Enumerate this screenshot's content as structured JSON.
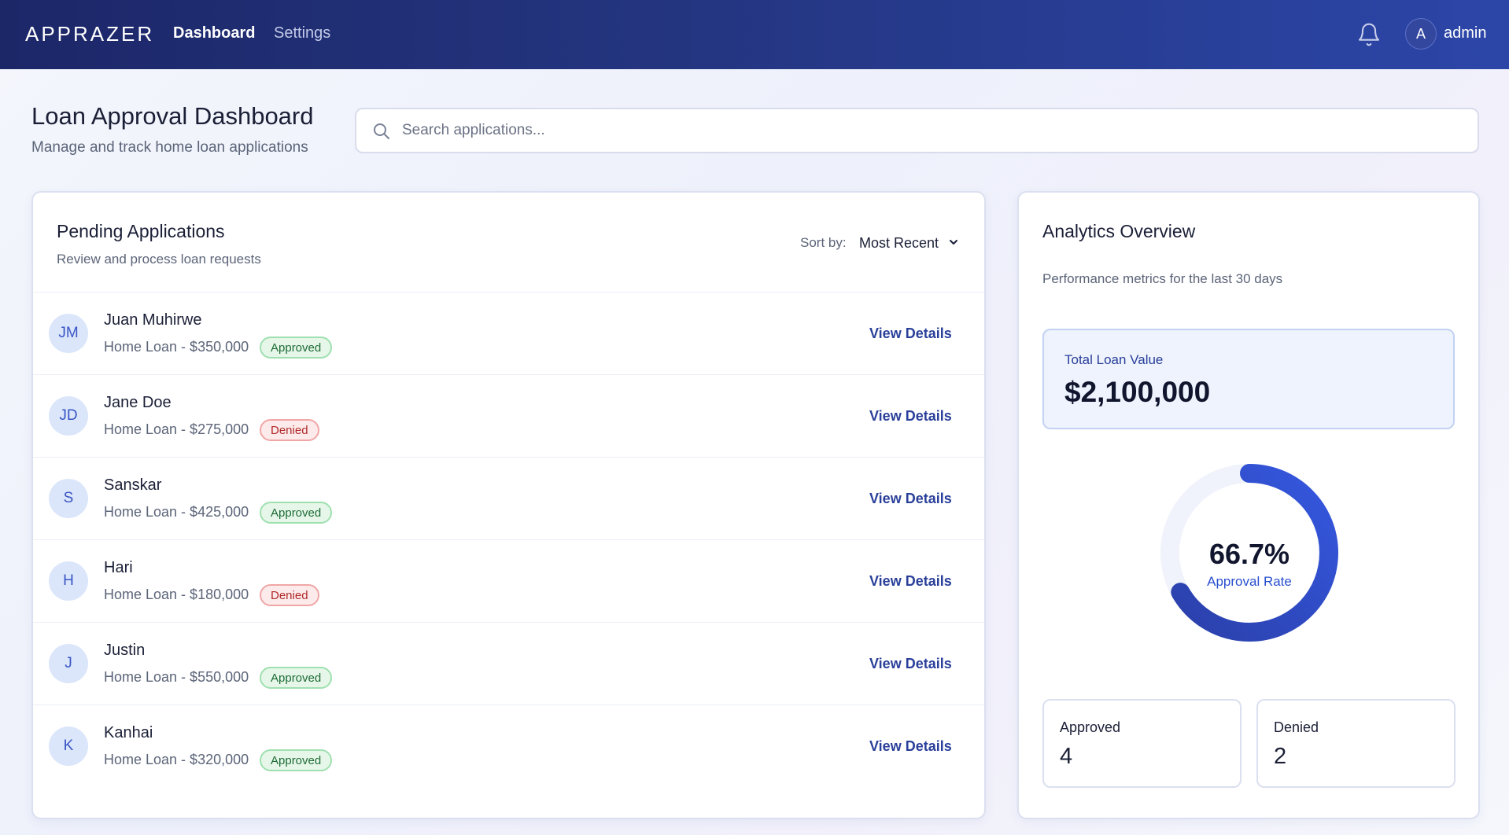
{
  "nav": {
    "logo": "APPRAZER",
    "links": [
      "Dashboard",
      "Settings"
    ],
    "active": "Dashboard",
    "user_initial": "A",
    "user_name": "admin"
  },
  "header": {
    "title": "Loan Approval Dashboard",
    "subtitle": "Manage and track home loan applications"
  },
  "search": {
    "placeholder": "Search applications...",
    "value": ""
  },
  "pending": {
    "title": "Pending Applications",
    "subtitle": "Review and process loan requests",
    "sort_label": "Sort by:",
    "sort_value": "Most Recent",
    "action_label": "View Details",
    "applications": [
      {
        "initials": "JM",
        "name": "Juan Muhirwe",
        "amount": "Home Loan - $350,000",
        "status": "Approved"
      },
      {
        "initials": "JD",
        "name": "Jane Doe",
        "amount": "Home Loan - $275,000",
        "status": "Denied"
      },
      {
        "initials": "S",
        "name": "Sanskar",
        "amount": "Home Loan - $425,000",
        "status": "Approved"
      },
      {
        "initials": "H",
        "name": "Hari",
        "amount": "Home Loan - $180,000",
        "status": "Denied"
      },
      {
        "initials": "J",
        "name": "Justin",
        "amount": "Home Loan - $550,000",
        "status": "Approved"
      },
      {
        "initials": "K",
        "name": "Kanhai",
        "amount": "Home Loan - $320,000",
        "status": "Approved"
      }
    ]
  },
  "analytics": {
    "title": "Analytics Overview",
    "subtitle": "Performance metrics for the last 30 days",
    "total_label": "Total Loan Value",
    "total_value": "$2,100,000",
    "approval_rate_text": "66.7%",
    "approval_rate": 0.667,
    "approval_rate_label": "Approval Rate",
    "approved_label": "Approved",
    "approved_count": "4",
    "denied_label": "Denied",
    "denied_count": "2"
  },
  "colors": {
    "nav_start": "#1c2768",
    "nav_end": "#2c46a8",
    "accent": "#2a3f9a",
    "donut": "#2f4fd6",
    "approved_bg": "#e6f7ea",
    "denied_bg": "#fdeaea"
  },
  "icons": {
    "bell": "bell-icon",
    "search": "search-icon",
    "sort": "chevron-down-icon"
  }
}
